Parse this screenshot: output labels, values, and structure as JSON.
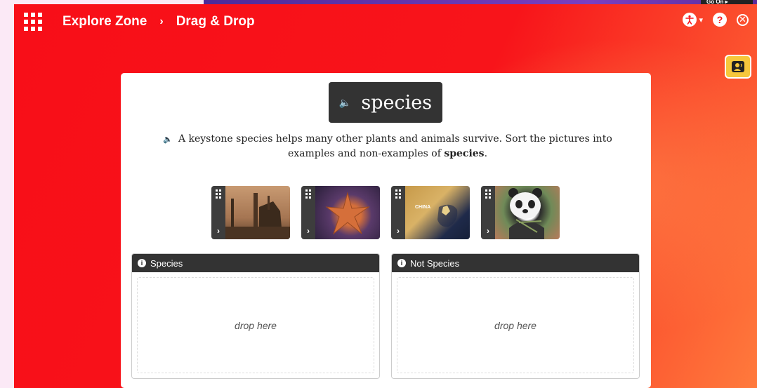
{
  "banner": {
    "go_on_label": "Go On ▸"
  },
  "header": {
    "breadcrumb": [
      "Explore Zone",
      "Drag & Drop"
    ],
    "separator": "›",
    "accessibility_icon": "accessibility-icon",
    "help_symbol": "?",
    "close_symbol": "✕"
  },
  "activity": {
    "word": "species",
    "instruction": "A keystone species helps many other plants and animals survive. Sort the pictures into examples and non-examples of",
    "instruction_bold": "species",
    "instruction_end": ".",
    "items": [
      {
        "label": "",
        "icon": "factory-image"
      },
      {
        "label": "",
        "icon": "starfish-image"
      },
      {
        "label": "CHINA",
        "icon": "china-map-image"
      },
      {
        "label": "",
        "icon": "panda-image"
      }
    ],
    "zones": [
      {
        "title": "Species",
        "placeholder": "drop here"
      },
      {
        "title": "Not Species",
        "placeholder": "drop here"
      }
    ]
  },
  "colors": {
    "brand_red": "#f8141a",
    "dark": "#333333",
    "audio_yellow": "#f6c73c"
  }
}
